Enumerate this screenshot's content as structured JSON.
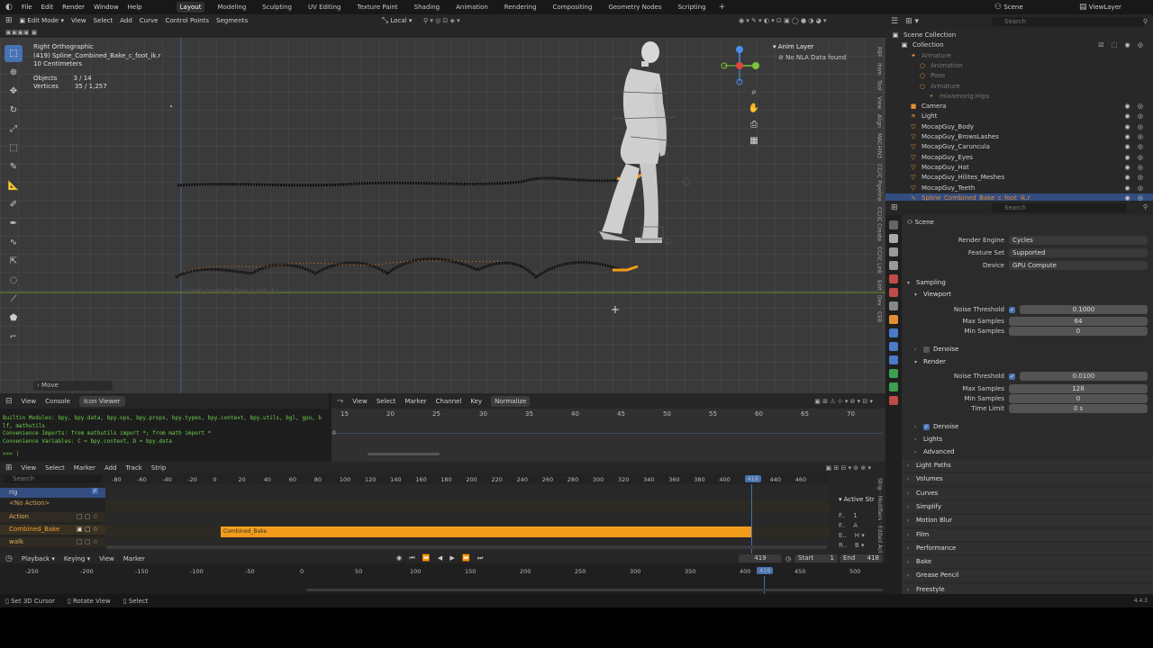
{
  "topbar": {
    "menus": [
      "File",
      "Edit",
      "Render",
      "Window",
      "Help"
    ],
    "workspaces": [
      "Layout",
      "Modeling",
      "Sculpting",
      "UV Editing",
      "Texture Paint",
      "Shading",
      "Animation",
      "Rendering",
      "Compositing",
      "Geometry Nodes",
      "Scripting"
    ],
    "active_workspace": "Layout",
    "scene": "Scene",
    "view_layer": "ViewLayer"
  },
  "viewport": {
    "mode": "Edit Mode",
    "menus": [
      "View",
      "Select",
      "Add",
      "Curve",
      "Control Points",
      "Segments"
    ],
    "orientation": "Local",
    "view_name": "Right Orthographic",
    "object_line": "(419) Spline_Combined_Bake_c_foot_ik.r",
    "scale": "10 Centimeters",
    "objects_label": "Objects",
    "objects_value": "3 / 14",
    "vertices_label": "Vertices",
    "vertices_value": "35 / 1,257",
    "curve_label": "Spline_Combined_Bake_c_foot_ik.r",
    "move_panel": "Move",
    "nla_title": "Anim Layer",
    "nla_msg": "No NLA Data found",
    "side_tabs": [
      "RBF",
      "Item",
      "Tool",
      "View",
      "Align",
      "MACHIN3",
      "CC/iC Pipeline",
      "CC/iC Create",
      "CC/iC Link",
      "Edit",
      "Dev",
      "CEB"
    ]
  },
  "console": {
    "tabs": [
      "View",
      "Console"
    ],
    "active_tab": "Icon Viewer",
    "lines": [
      "Builtin Modules:     bpy, bpy.data, bpy.ops, bpy.props, bpy.types, bpy.context, bpy.utils, bgl, gpu, b",
      "lf, mathutils",
      "Convenience Imports:   from mathutils import *; from math import *",
      "Convenience Variables: C = bpy.context, D = bpy.data"
    ],
    "prompt": ">>> |"
  },
  "graph": {
    "menus": [
      "View",
      "Select",
      "Marker",
      "Channel",
      "Key"
    ],
    "normalize": "Normalize",
    "ticks": [
      "15",
      "20",
      "25",
      "30",
      "35",
      "40",
      "45",
      "50",
      "55",
      "60",
      "65",
      "70"
    ],
    "zero": "0"
  },
  "nla": {
    "menus": [
      "View",
      "Select",
      "Marker",
      "Add",
      "Track",
      "Strip"
    ],
    "search_placeholder": "Search",
    "tracks": [
      {
        "name": "rig",
        "color": "#4a9eff"
      },
      {
        "name": "<No Action>",
        "color": "#d8a24a"
      },
      {
        "name": "Action",
        "color": "#e0b060"
      },
      {
        "name": "Combined_Bake",
        "color": "#f0a030"
      },
      {
        "name": "walk",
        "color": "#e0b060"
      }
    ],
    "ticks": [
      "-80",
      "-60",
      "-40",
      "-20",
      "0",
      "20",
      "40",
      "60",
      "80",
      "100",
      "120",
      "140",
      "160",
      "180",
      "200",
      "220",
      "240",
      "260",
      "280",
      "300",
      "320",
      "340",
      "360",
      "380",
      "400",
      "419",
      "440",
      "460"
    ],
    "strip_label": "Combined_Bake",
    "side_title": "Active Str"
  },
  "timeline": {
    "menus": [
      "Playback",
      "Keying",
      "View",
      "Marker"
    ],
    "current_frame": "419",
    "start_label": "Start",
    "start": "1",
    "end_label": "End",
    "end": "418",
    "ticks": [
      "-250",
      "-200",
      "-150",
      "-100",
      "-50",
      "0",
      "50",
      "100",
      "150",
      "200",
      "250",
      "300",
      "350",
      "400",
      "450",
      "500"
    ]
  },
  "outliner": {
    "search_placeholder": "Search",
    "rows": [
      {
        "name": "Scene Collection",
        "indent": 0,
        "dim": false,
        "icon": "▣"
      },
      {
        "name": "Collection",
        "indent": 1,
        "dim": false,
        "icon": "▣"
      },
      {
        "name": "Armature",
        "indent": 2,
        "dim": true,
        "icon": "✦"
      },
      {
        "name": "Animation",
        "indent": 3,
        "dim": true,
        "icon": "○"
      },
      {
        "name": "Pose",
        "indent": 3,
        "dim": true,
        "icon": "○"
      },
      {
        "name": "Armature",
        "indent": 3,
        "dim": true,
        "icon": "○"
      },
      {
        "name": "mixamorig:Hips",
        "indent": 4,
        "dim": true,
        "icon": "•"
      },
      {
        "name": "Camera",
        "indent": 2,
        "dim": false,
        "icon": "■"
      },
      {
        "name": "Light",
        "indent": 2,
        "dim": false,
        "icon": "☀"
      },
      {
        "name": "MocapGuy_Body",
        "indent": 2,
        "dim": false,
        "icon": "▽"
      },
      {
        "name": "MocapGuy_BrowsLashes",
        "indent": 2,
        "dim": false,
        "icon": "▽"
      },
      {
        "name": "MocapGuy_Caruncula",
        "indent": 2,
        "dim": false,
        "icon": "▽"
      },
      {
        "name": "MocapGuy_Eyes",
        "indent": 2,
        "dim": false,
        "icon": "▽"
      },
      {
        "name": "MocapGuy_Hat",
        "indent": 2,
        "dim": false,
        "icon": "▽"
      },
      {
        "name": "MocapGuy_Hilites_Meshes",
        "indent": 2,
        "dim": false,
        "icon": "▽"
      },
      {
        "name": "MocapGuy_Teeth",
        "indent": 2,
        "dim": false,
        "icon": "▽"
      },
      {
        "name": "Spline_Combined_Bake_c_foot_ik.r",
        "indent": 2,
        "dim": false,
        "icon": "∿",
        "highlight": true
      }
    ]
  },
  "properties": {
    "search_placeholder": "Search",
    "context": "Scene",
    "render_engine_label": "Render Engine",
    "render_engine": "Cycles",
    "feature_set_label": "Feature Set",
    "feature_set": "Supported",
    "device_label": "Device",
    "device": "GPU Compute",
    "sampling": "Sampling",
    "viewport": "Viewport",
    "vp_noise_label": "Noise Threshold",
    "vp_noise": "0.1000",
    "vp_max_label": "Max Samples",
    "vp_max": "64",
    "vp_min_label": "Min Samples",
    "vp_min": "0",
    "denoise": "Denoise",
    "render": "Render",
    "r_noise_label": "Noise Threshold",
    "r_noise": "0.0100",
    "r_max_label": "Max Samples",
    "r_max": "128",
    "r_min_label": "Min Samples",
    "r_min": "0",
    "time_limit_label": "Time Limit",
    "time_limit": "0 s",
    "denoise2": "Denoise",
    "lights": "Lights",
    "advanced": "Advanced",
    "sections": [
      "Light Paths",
      "Volumes",
      "Curves",
      "Simplify",
      "Motion Blur",
      "Film",
      "Performance",
      "Bake",
      "Grease Pencil",
      "Freestyle"
    ]
  },
  "statusbar": {
    "items": [
      "Set 3D Cursor",
      "Rotate View",
      "Select"
    ],
    "version": "4.4.3"
  },
  "colors": {
    "accent": "#4772b3",
    "selected_orange": "#f39c1c",
    "console_green": "#6fcf4b"
  }
}
